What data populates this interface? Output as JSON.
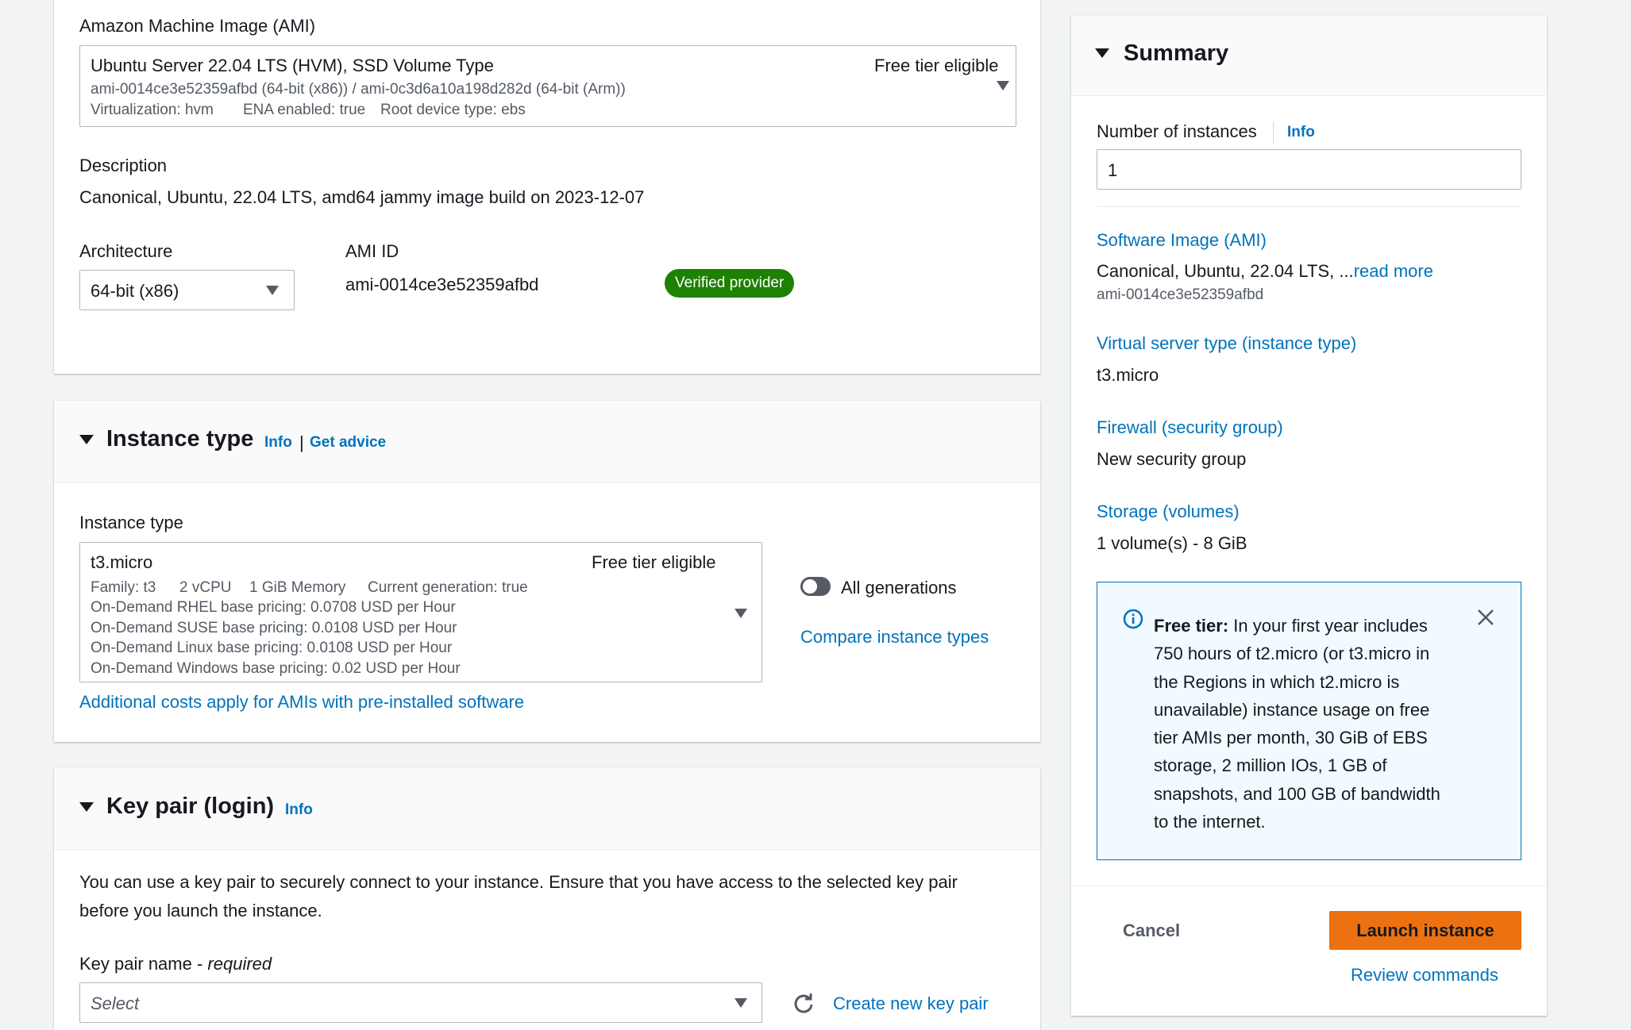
{
  "ami": {
    "section_label": "Amazon Machine Image (AMI)",
    "name": "Ubuntu Server 22.04 LTS (HVM), SSD Volume Type",
    "free_tier": "Free tier eligible",
    "ids": "ami-0014ce3e52359afbd (64-bit (x86)) / ami-0c3d6a10a198d282d (64-bit (Arm))",
    "virtualization": "Virtualization: hvm",
    "ena": "ENA enabled: true",
    "root_device": "Root device type: ebs",
    "description_label": "Description",
    "description": "Canonical, Ubuntu, 22.04 LTS, amd64 jammy image build on 2023-12-07",
    "architecture_label": "Architecture",
    "architecture_value": "64-bit (x86)",
    "ami_id_label": "AMI ID",
    "ami_id": "ami-0014ce3e52359afbd",
    "verified_badge": "Verified provider"
  },
  "instance_type": {
    "title": "Instance type",
    "info": "Info",
    "separator": "|",
    "get_advice": "Get advice",
    "field_label": "Instance type",
    "selected": "t3.micro",
    "free_tier": "Free tier eligible",
    "family": "Family: t3",
    "vcpu": "2 vCPU",
    "memory": "1 GiB Memory",
    "generation": "Current generation: true",
    "pricing": [
      "On-Demand RHEL base pricing: 0.0708 USD per Hour",
      "On-Demand SUSE base pricing: 0.0108 USD per Hour",
      "On-Demand Linux base pricing: 0.0108 USD per Hour",
      "On-Demand Windows base pricing: 0.02 USD per Hour"
    ],
    "all_generations": "All generations",
    "compare": "Compare instance types",
    "additional_costs": "Additional costs apply for AMIs with pre-installed software"
  },
  "key_pair": {
    "title": "Key pair (login)",
    "info": "Info",
    "description_line1": "You can use a key pair to securely connect to your instance. Ensure that you have access to the selected key pair",
    "description_line2": "before you launch the instance.",
    "name_label": "Key pair name - ",
    "required": "required",
    "select_placeholder": "Select",
    "create_new": "Create new key pair"
  },
  "summary": {
    "title": "Summary",
    "num_instances_label": "Number of instances",
    "info": "Info",
    "num_instances_value": "1",
    "software_image_label": "Software Image (AMI)",
    "software_image_value": "Canonical, Ubuntu, 22.04 LTS, ...",
    "read_more": "read more",
    "software_image_id": "ami-0014ce3e52359afbd",
    "server_type_label": "Virtual server type (instance type)",
    "server_type_value": "t3.micro",
    "firewall_label": "Firewall (security group)",
    "firewall_value": "New security group",
    "storage_label": "Storage (volumes)",
    "storage_value": "1 volume(s) - 8 GiB",
    "free_tier_title": "Free tier:",
    "free_tier_lines": [
      " In your first year includes",
      "750 hours of t2.micro (or t3.micro in",
      "the Regions in which t2.micro is",
      "unavailable) instance usage on free",
      "tier AMIs per month, 30 GiB of EBS",
      "storage, 2 million IOs, 1 GB of",
      "snapshots, and 100 GB of bandwidth",
      "to the internet."
    ],
    "cancel": "Cancel",
    "launch": "Launch instance",
    "review": "Review commands"
  },
  "colors": {
    "link": "#0073bb",
    "launch_button": "#ec7211",
    "verified_badge": "#1d8102",
    "info_box_bg": "#f1faff",
    "info_box_border": "#0073bb"
  },
  "icons": [
    "dropdown-caret-icon",
    "expand-caret-icon",
    "info-circle-icon",
    "close-icon",
    "refresh-icon",
    "toggle-switch"
  ]
}
